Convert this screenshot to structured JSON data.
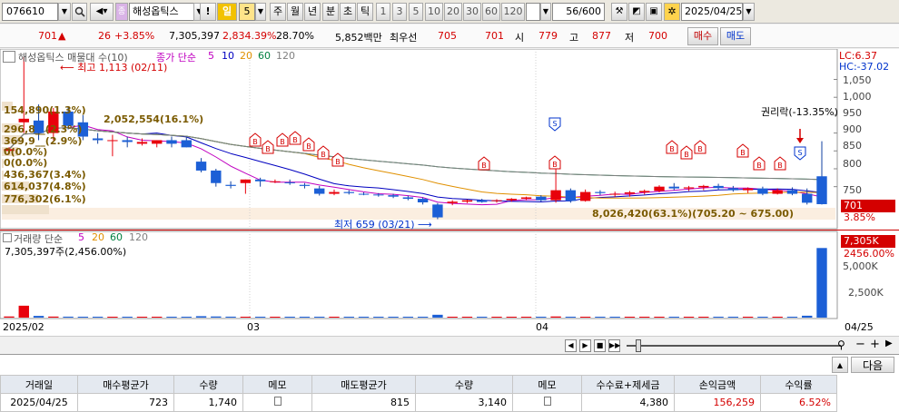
{
  "toolbar": {
    "code": "076610",
    "stock_name": "해성옵틱스",
    "excl": "!",
    "period": "일",
    "period_num": "5",
    "tabs": [
      "주",
      "월",
      "년",
      "분",
      "초",
      "틱"
    ],
    "minute_options": [
      "1",
      "3",
      "5",
      "10",
      "20",
      "30",
      "60",
      "120"
    ],
    "bar_count": "56/600",
    "date": "2025/04/25"
  },
  "info": {
    "price": "701",
    "up_arrow": "▲",
    "change": "26",
    "change_pct": "+3.85%",
    "volume": "7,305,397",
    "vol_ratio": "2,834.39%",
    "turnover": "28.70%",
    "amount": "5,852백만",
    "best_label": "최우선",
    "bid": "705",
    "ask": "701",
    "open_label": "시",
    "open": "779",
    "high_label": "고",
    "high": "877",
    "low_label": "저",
    "low": "700",
    "buy_button": "매수",
    "sell_button": "매도"
  },
  "chart": {
    "legend_name": "해성옵틱스 매물대 수(10)",
    "legend_ma_prefix": "종가 단순",
    "ma_periods": [
      "5",
      "10",
      "20",
      "60",
      "120"
    ],
    "ma_colors": {
      "5": "#c000c0",
      "10": "#0000c0",
      "20": "#e09000",
      "60": "#008040",
      "120": "#808080"
    },
    "lc": "LC:6.37",
    "hc": "HC:-37.02",
    "high_note": "최고 1,113 (02/11)",
    "low_note": "최저 659 (03/21)",
    "rights_note": "권리락(-13.35%)",
    "volume_profile": [
      "154,890(1.3%)",
      "2,052,554(16.1%)",
      "296,8__(2.3%)",
      "369,9__(2.9%)",
      "0(0.0%)",
      "0(0.0%)",
      "436,367(3.4%)",
      "614,037(4.8%)",
      "776,302(6.1%)"
    ],
    "profile_max": "8,026,420(63.1%)(705.20 ~ 675.00)",
    "price_axis": [
      "1,050",
      "1,000",
      "950",
      "900",
      "850",
      "800",
      "750"
    ],
    "price_tag": "701",
    "price_tag_pct": "3.85%",
    "volume_legend_prefix": "거래량 단순",
    "volume_ma": [
      "5",
      "20",
      "60",
      "120"
    ],
    "volume_stat": "7,305,397주(2,456.00%)",
    "volume_tag": "7,305K",
    "volume_tag_pct": "2456.00%",
    "volume_axis": [
      "5,000K",
      "2,500K"
    ],
    "date_labels": [
      "2025/02",
      "03",
      "04",
      "04/25"
    ]
  },
  "chart_data": {
    "type": "candlestick",
    "candles": [
      {
        "o": 850,
        "h": 860,
        "l": 840,
        "c": 855
      },
      {
        "o": 930,
        "h": 1113,
        "l": 900,
        "c": 940
      },
      {
        "o": 935,
        "h": 980,
        "l": 880,
        "c": 900
      },
      {
        "o": 900,
        "h": 970,
        "l": 880,
        "c": 960
      },
      {
        "o": 960,
        "h": 975,
        "l": 910,
        "c": 920
      },
      {
        "o": 930,
        "h": 950,
        "l": 880,
        "c": 890
      },
      {
        "o": 885,
        "h": 900,
        "l": 870,
        "c": 880
      },
      {
        "o": 880,
        "h": 895,
        "l": 835,
        "c": 880
      },
      {
        "o": 880,
        "h": 890,
        "l": 860,
        "c": 875
      },
      {
        "o": 870,
        "h": 885,
        "l": 865,
        "c": 875
      },
      {
        "o": 870,
        "h": 880,
        "l": 860,
        "c": 880
      },
      {
        "o": 880,
        "h": 890,
        "l": 860,
        "c": 870
      },
      {
        "o": 880,
        "h": 890,
        "l": 860,
        "c": 860
      },
      {
        "o": 820,
        "h": 830,
        "l": 790,
        "c": 795
      },
      {
        "o": 795,
        "h": 800,
        "l": 750,
        "c": 760
      },
      {
        "o": 755,
        "h": 765,
        "l": 745,
        "c": 752
      },
      {
        "o": 760,
        "h": 770,
        "l": 730,
        "c": 770
      },
      {
        "o": 770,
        "h": 775,
        "l": 750,
        "c": 765
      },
      {
        "o": 765,
        "h": 770,
        "l": 760,
        "c": 765
      },
      {
        "o": 762,
        "h": 770,
        "l": 755,
        "c": 760
      },
      {
        "o": 755,
        "h": 760,
        "l": 745,
        "c": 752
      },
      {
        "o": 745,
        "h": 752,
        "l": 725,
        "c": 730
      },
      {
        "o": 730,
        "h": 742,
        "l": 726,
        "c": 735
      },
      {
        "o": 735,
        "h": 740,
        "l": 728,
        "c": 732
      },
      {
        "o": 730,
        "h": 734,
        "l": 726,
        "c": 728
      },
      {
        "o": 728,
        "h": 732,
        "l": 722,
        "c": 726
      },
      {
        "o": 726,
        "h": 730,
        "l": 718,
        "c": 722
      },
      {
        "o": 720,
        "h": 725,
        "l": 712,
        "c": 716
      },
      {
        "o": 716,
        "h": 720,
        "l": 700,
        "c": 706
      },
      {
        "o": 700,
        "h": 704,
        "l": 659,
        "c": 664
      },
      {
        "o": 704,
        "h": 712,
        "l": 698,
        "c": 708
      },
      {
        "o": 708,
        "h": 714,
        "l": 704,
        "c": 712
      },
      {
        "o": 712,
        "h": 716,
        "l": 705,
        "c": 707
      },
      {
        "o": 710,
        "h": 715,
        "l": 705,
        "c": 712
      },
      {
        "o": 712,
        "h": 718,
        "l": 708,
        "c": 716
      },
      {
        "o": 716,
        "h": 722,
        "l": 712,
        "c": 720
      },
      {
        "o": 722,
        "h": 726,
        "l": 708,
        "c": 712
      },
      {
        "o": 712,
        "h": 810,
        "l": 705,
        "c": 740
      },
      {
        "o": 740,
        "h": 745,
        "l": 705,
        "c": 710
      },
      {
        "o": 710,
        "h": 742,
        "l": 708,
        "c": 735
      },
      {
        "o": 735,
        "h": 740,
        "l": 726,
        "c": 732
      },
      {
        "o": 728,
        "h": 736,
        "l": 722,
        "c": 730
      },
      {
        "o": 730,
        "h": 738,
        "l": 722,
        "c": 734
      },
      {
        "o": 734,
        "h": 742,
        "l": 728,
        "c": 738
      },
      {
        "o": 738,
        "h": 754,
        "l": 734,
        "c": 750
      },
      {
        "o": 750,
        "h": 760,
        "l": 740,
        "c": 745
      },
      {
        "o": 745,
        "h": 752,
        "l": 738,
        "c": 748
      },
      {
        "o": 748,
        "h": 755,
        "l": 740,
        "c": 752
      },
      {
        "o": 752,
        "h": 758,
        "l": 742,
        "c": 746
      },
      {
        "o": 746,
        "h": 752,
        "l": 736,
        "c": 740
      },
      {
        "o": 740,
        "h": 748,
        "l": 732,
        "c": 745
      },
      {
        "o": 745,
        "h": 750,
        "l": 726,
        "c": 730
      },
      {
        "o": 730,
        "h": 745,
        "l": 728,
        "c": 740
      },
      {
        "o": 740,
        "h": 748,
        "l": 726,
        "c": 730
      },
      {
        "o": 730,
        "h": 745,
        "l": 700,
        "c": 705
      },
      {
        "o": 779,
        "h": 877,
        "l": 700,
        "c": 701
      }
    ],
    "volumes": [
      0.12,
      1.25,
      0.18,
      0.11,
      0.1,
      0.09,
      0.07,
      0.08,
      0.06,
      0.05,
      0.06,
      0.05,
      0.06,
      0.15,
      0.12,
      0.1,
      0.09,
      0.08,
      0.07,
      0.06,
      0.06,
      0.09,
      0.07,
      0.06,
      0.05,
      0.05,
      0.06,
      0.05,
      0.08,
      0.3,
      0.09,
      0.07,
      0.06,
      0.07,
      0.06,
      0.07,
      0.06,
      0.12,
      0.09,
      0.08,
      0.06,
      0.06,
      0.07,
      0.06,
      0.09,
      0.07,
      0.06,
      0.06,
      0.06,
      0.06,
      0.07,
      0.06,
      0.06,
      0.07,
      0.2,
      7.305
    ],
    "volume_unit": "M",
    "ylim": [
      640,
      1130
    ]
  },
  "scroll": {
    "buttons": [
      "◀",
      "▶",
      "■",
      "▶▶"
    ],
    "zoom_out": "−",
    "zoom_in": "+",
    "magnifier": "🔍"
  },
  "table": {
    "next_button": "다음",
    "headers": [
      "거래일",
      "매수평균가",
      "수량",
      "메모",
      "매도평균가",
      "수량",
      "메모",
      "수수료+제세금",
      "손익금액",
      "수익률"
    ],
    "rows": [
      [
        "2025/04/25",
        "723",
        "1,740",
        "",
        "815",
        "3,140",
        "",
        "4,380",
        "156,259",
        "6.52%"
      ]
    ]
  }
}
